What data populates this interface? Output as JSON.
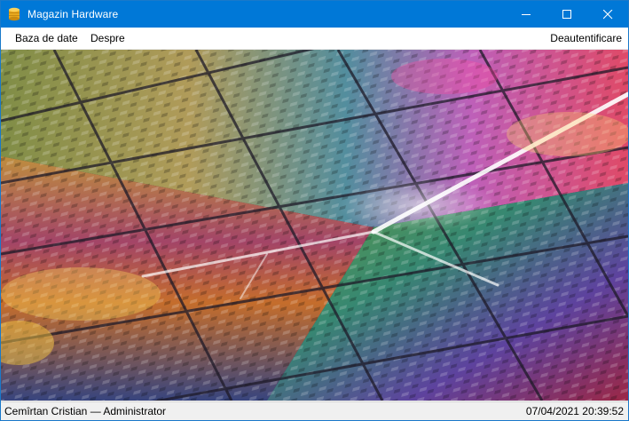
{
  "window": {
    "title": "Magazin Hardware",
    "icon": "database-cylinder-icon",
    "accent_color": "#0078d7"
  },
  "menu": {
    "database": "Baza de date",
    "about": "Despre",
    "logout": "Deautentificare"
  },
  "content": {
    "image": "cpu-wafer-image"
  },
  "status": {
    "user": "Cemîrtan Cristian — Administrator",
    "datetime": "07/04/2021 20:39:52"
  }
}
